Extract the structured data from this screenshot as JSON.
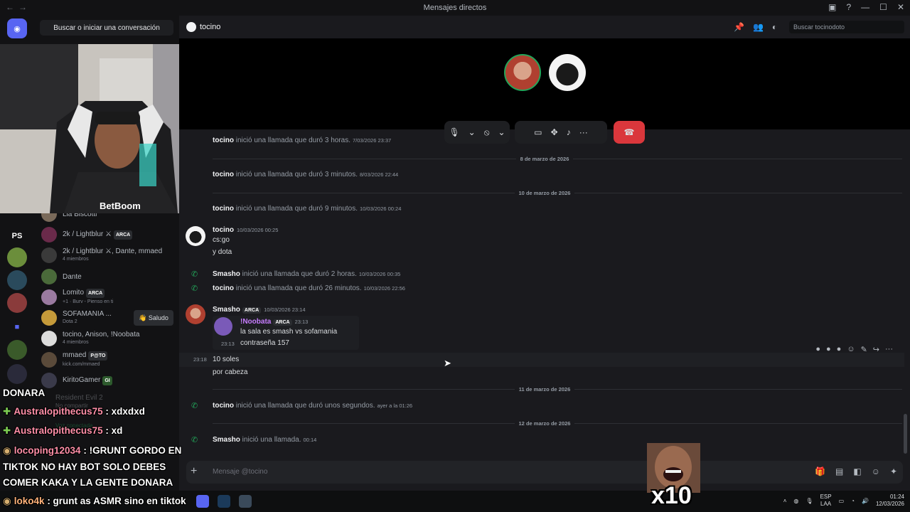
{
  "window": {
    "title": "Mensajes directos"
  },
  "dm_sidebar": {
    "search_label": "Buscar o iniciar una conversación",
    "items": [
      {
        "name": "Lia Biscotti",
        "sub": "",
        "tag": ""
      },
      {
        "name": "2k / Lightblur ⚔",
        "sub": "",
        "tag": "ARCA"
      },
      {
        "name": "2k / Lightblur ⚔, Dante, mmaed",
        "sub": "4 miembros",
        "tag": ""
      },
      {
        "name": "Dante",
        "sub": "",
        "tag": ""
      },
      {
        "name": "Lomito",
        "sub": "+1 · Burv - Pienso en ti",
        "tag": "ARCA"
      },
      {
        "name": "SOFAMANIA ...",
        "sub": "Dota 2",
        "tag": ""
      },
      {
        "name": "tocino, Anison, !Noobata",
        "sub": "4 miembros",
        "tag": ""
      },
      {
        "name": "mmaed",
        "sub": "kick.com/mmaed",
        "tag": "P@TO"
      },
      {
        "name": "KiritoGamer",
        "sub": "",
        "tag": "GI"
      }
    ],
    "saludo_label": "Saludo",
    "guild_ps": "PS"
  },
  "header": {
    "channel_name": "tocino",
    "search_placeholder": "Buscar tocinodoto"
  },
  "messages": {
    "sys1": {
      "user": "tocino",
      "text": " inició una llamada que duró 3 horas.",
      "ts": "7/03/2026 23:37"
    },
    "date1": "8 de marzo de 2026",
    "sys2": {
      "user": "tocino",
      "text": " inició una llamada que duró 3 minutos.",
      "ts": "8/03/2026 22:44"
    },
    "date2": "10 de marzo de 2026",
    "sys3": {
      "user": "tocino",
      "text": " inició una llamada que duró 9 minutos.",
      "ts": "10/03/2026 00:24"
    },
    "msg1": {
      "author": "tocino",
      "ts": "10/03/2026 00:25",
      "lines": [
        "cs:go",
        "y dota"
      ]
    },
    "sys4": {
      "user": "Smasho",
      "text": " inició una llamada que duró 2 horas.",
      "ts": "10/03/2026 00:35"
    },
    "sys5": {
      "user": "tocino",
      "text": " inició una llamada que duró 26 minutos.",
      "ts": "10/03/2026 22:56"
    },
    "msg2": {
      "author": "Smasho",
      "tag": "ARCA",
      "ts": "10/03/2026 23:14",
      "reply": {
        "author": "!Noobata",
        "tag": "ARCA",
        "ts": "23:13",
        "text": "la sala es smash vs sofamania",
        "text2": "contraseña 157",
        "ts2": "23:13"
      },
      "follow_ts": "23:18",
      "lines": [
        "10 soles",
        "por cabeza"
      ]
    },
    "date3": "11 de marzo de 2026",
    "sys6": {
      "user": "tocino",
      "text": " inició una llamada que duró unos segundos.",
      "ts": "ayer a la 01:26"
    },
    "date4": "12 de marzo de 2026",
    "sys7": {
      "user": "Smasho",
      "text": " inició una llamada.",
      "ts": "00:14"
    }
  },
  "composer": {
    "placeholder": "Mensaje @tocino"
  },
  "stream_chat": {
    "title": "DONARA",
    "lines": [
      {
        "user": "Australopithecus75",
        "text": " : xdxdxd"
      },
      {
        "user": "Australopithecus75",
        "text": " : xd"
      },
      {
        "user": "locoping12034",
        "text": " : !GRUNT GORDO EN"
      },
      {
        "user": "",
        "text": "TIKTOK NO HAY BOT SOLO DEBES"
      },
      {
        "user": "",
        "text": "COMER KAKA Y LA GENTE DONARA"
      },
      {
        "user": "loko4k",
        "text": " : grunt as ASMR sino en tiktok"
      }
    ]
  },
  "hidden_panel": {
    "game": "Resident Evil 2",
    "share": "No compartir",
    "voice": "Voz conectada"
  },
  "taskbar": {
    "lang": "ESP",
    "lang2": "LAA",
    "time": "01:24",
    "date": "12/03/2026"
  },
  "emote": {
    "label": "x10"
  },
  "colors": {
    "accent": "#5865f2",
    "hangup": "#da373c",
    "call_green": "#23a55a",
    "chat_user": "#ff8fa8"
  }
}
